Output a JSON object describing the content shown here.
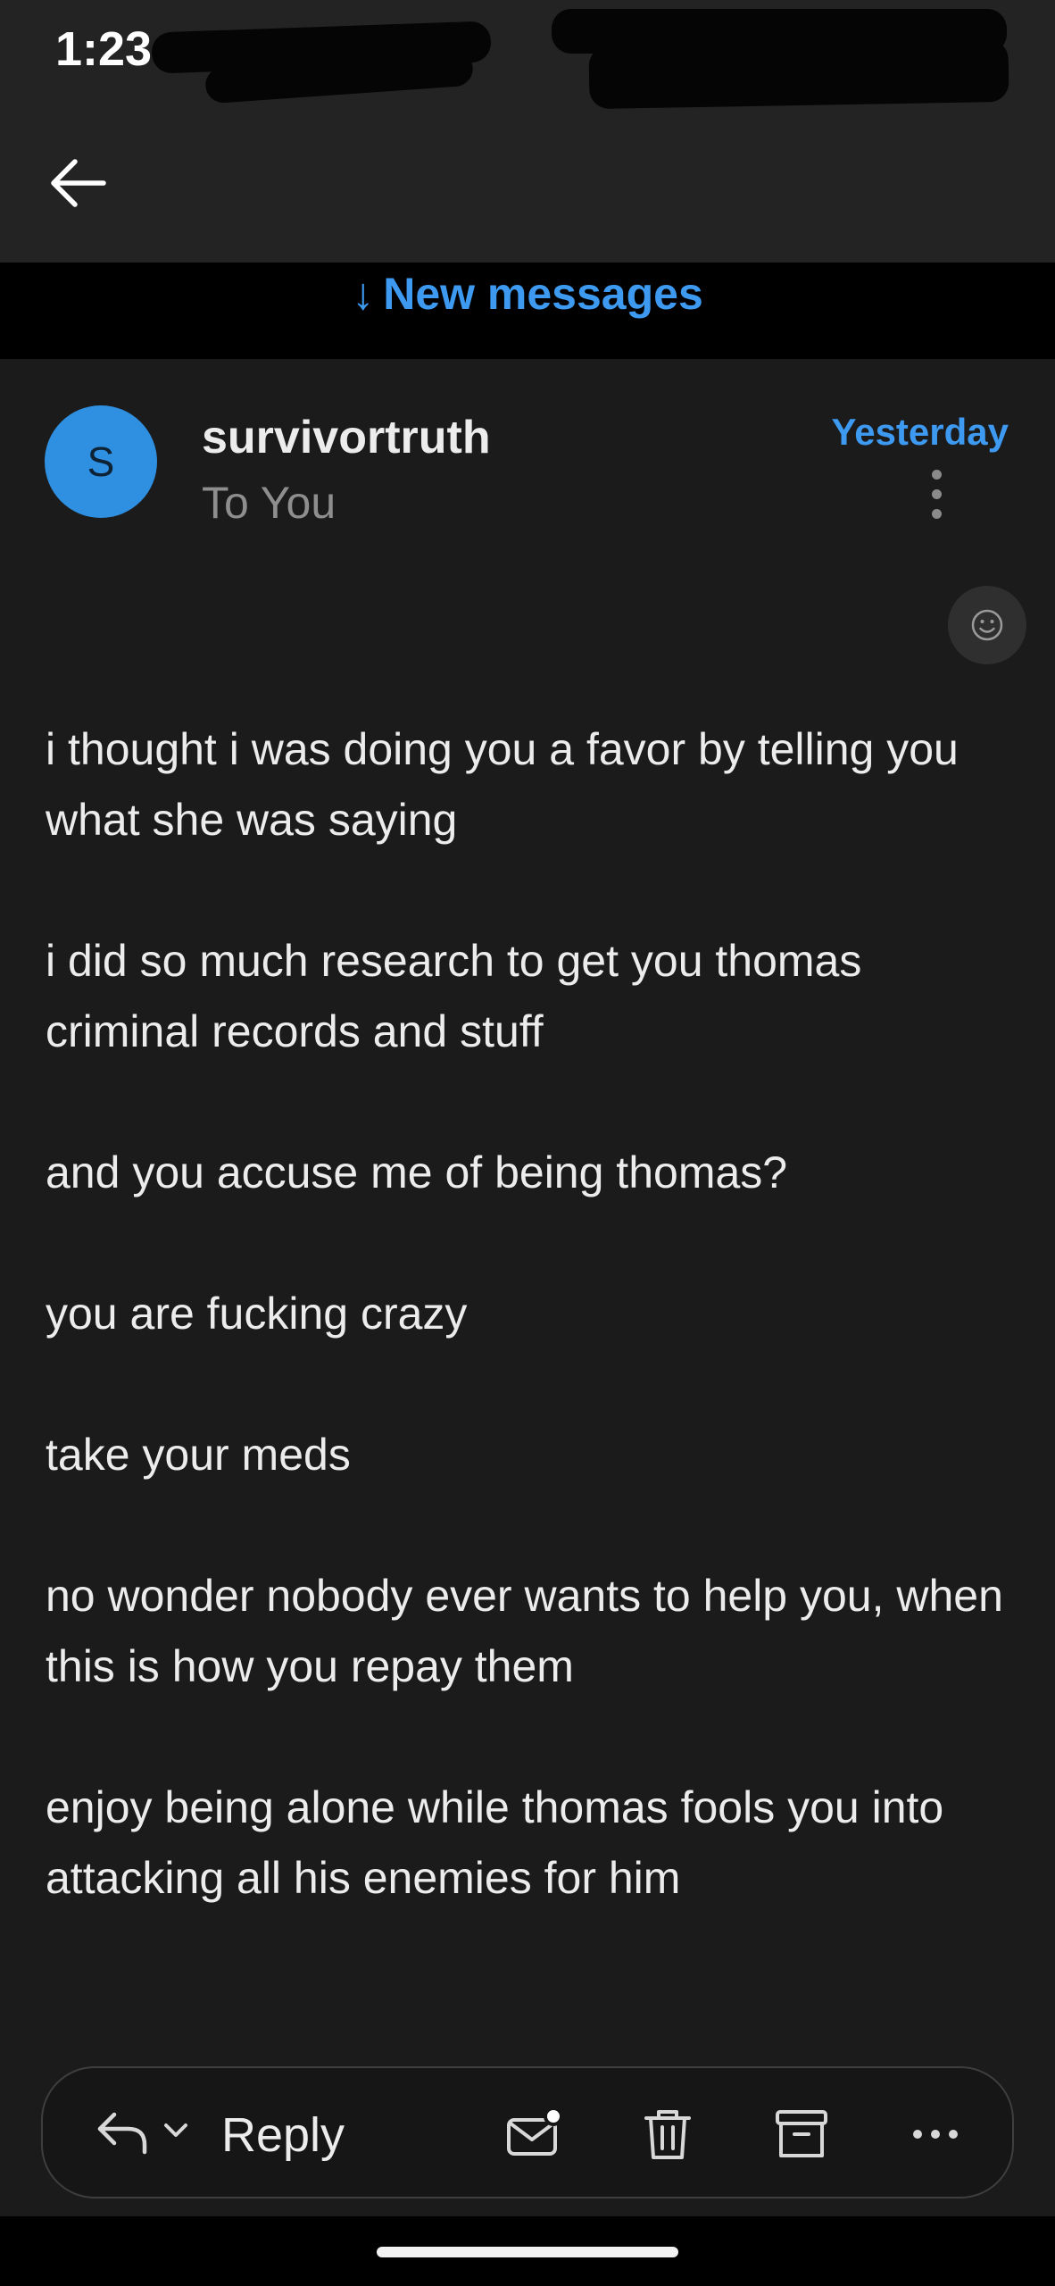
{
  "status_bar": {
    "time": "1:23"
  },
  "new_messages": {
    "label": "New messages"
  },
  "message": {
    "avatar_initial": "S",
    "sender": "survivortruth",
    "recipient": "To You",
    "date": "Yesterday",
    "paragraphs": [
      "i thought i was doing you a favor by telling you what she was saying",
      "i did so much research to get you thomas criminal records and stuff",
      "and you accuse me of being thomas?",
      "you are fucking crazy",
      "take your meds",
      "no wonder nobody ever wants to help you, when this is how you repay them",
      "enjoy being alone while thomas fools you into attacking all his enemies for him"
    ]
  },
  "reply_bar": {
    "reply_label": "Reply"
  },
  "colors": {
    "accent": "#3d9af0",
    "avatar": "#2f8fe0",
    "background": "#1b1b1c",
    "header": "#232323"
  },
  "icons": [
    "back-arrow-icon",
    "more-vertical-icon",
    "smiley-icon",
    "reply-icon",
    "chevron-down-icon",
    "mark-unread-icon",
    "trash-icon",
    "archive-icon",
    "more-horizontal-icon"
  ]
}
